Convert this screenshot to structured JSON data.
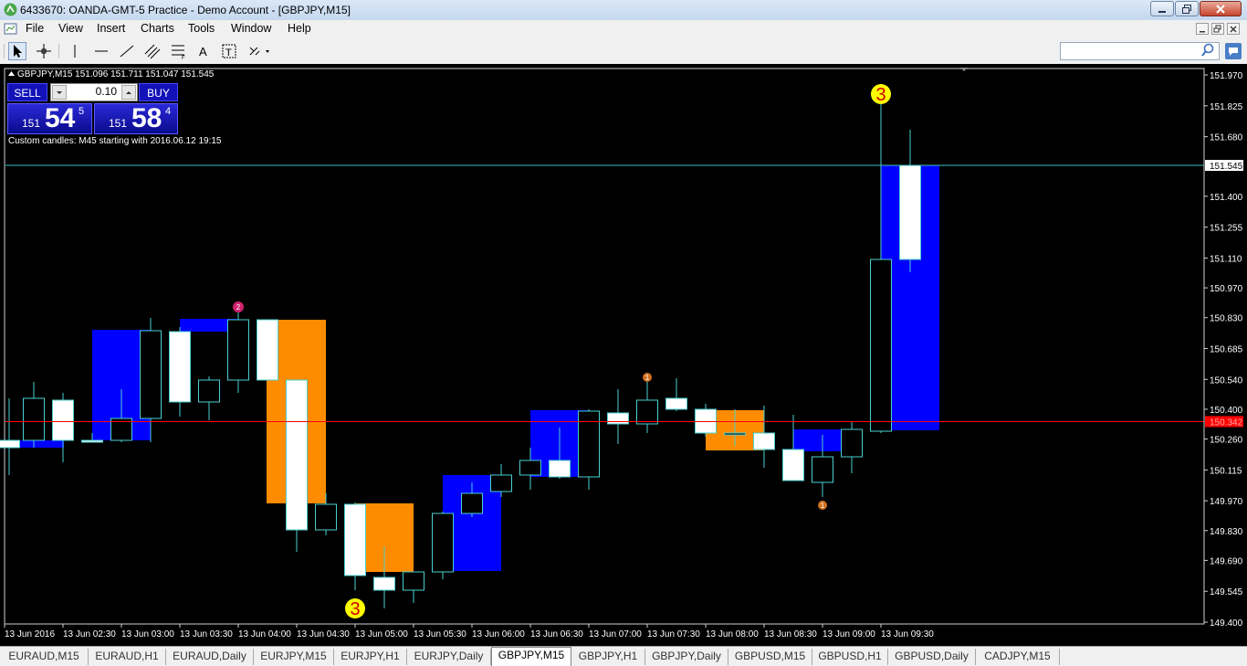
{
  "window": {
    "title": "6433670: OANDA-GMT-5 Practice - Demo Account - [GBPJPY,M15]"
  },
  "menu": [
    "File",
    "View",
    "Insert",
    "Charts",
    "Tools",
    "Window",
    "Help"
  ],
  "toolbar": {
    "icons": [
      "cursor-arrow-icon",
      "crosshair-icon",
      "vertical-line-icon",
      "horizontal-line-icon",
      "trendline-icon",
      "channel-icon",
      "fibonacci-icon",
      "text-icon",
      "text-label-icon",
      "arrows-icon"
    ],
    "search_placeholder": ""
  },
  "chart": {
    "header": "GBPJPY,M15  151.096 151.711 151.047 151.545",
    "note": "Custom candles: M45 starting with 2016.06.12 19:15",
    "quick_trade": {
      "sell_label": "SELL",
      "buy_label": "BUY",
      "lot": "0.10",
      "bid": {
        "big_prefix": "151",
        "big": "54",
        "sup": "5"
      },
      "ask": {
        "big_prefix": "151",
        "big": "58",
        "sup": "4"
      }
    },
    "price_axis": [
      "151.970",
      "151.825",
      "151.680",
      "151.545",
      "151.400",
      "151.255",
      "151.110",
      "150.970",
      "150.830",
      "150.685",
      "150.540",
      "150.400",
      "150.342",
      "150.260",
      "150.115",
      "149.970",
      "149.830",
      "149.690",
      "149.545",
      "149.400"
    ],
    "current_price": "151.545",
    "red_line_price": "150.342",
    "time_axis": [
      "13 Jun 2016",
      "13 Jun 02:30",
      "13 Jun 03:00",
      "13 Jun 03:30",
      "13 Jun 04:00",
      "13 Jun 04:30",
      "13 Jun 05:00",
      "13 Jun 05:30",
      "13 Jun 06:00",
      "13 Jun 06:30",
      "13 Jun 07:00",
      "13 Jun 07:30",
      "13 Jun 08:00",
      "13 Jun 08:30",
      "13 Jun 09:00",
      "13 Jun 09:30"
    ],
    "markers": [
      {
        "label": "3",
        "color": "#ffff00",
        "text_color": "#cc0000"
      },
      {
        "label": "3",
        "color": "#ffff00",
        "text_color": "#cc0000"
      },
      {
        "label": "2",
        "color": "#d02070",
        "text_color": "#ffffff"
      },
      {
        "label": "1",
        "color": "#d07020",
        "text_color": "#ffffff"
      },
      {
        "label": "1",
        "color": "#d07020",
        "text_color": "#ffffff"
      }
    ],
    "colors": {
      "bull": "#0000ff",
      "bear": "#ff8c00",
      "candle_outline": "#4ad0d0",
      "candle_body": "#ffffff",
      "bid_line": "#40c0c0",
      "red_line": "#ff0000"
    }
  },
  "symbol_tabs": [
    "EURAUD,M15",
    "EURAUD,H1",
    "EURAUD,Daily",
    "EURJPY,M15",
    "EURJPY,H1",
    "EURJPY,Daily",
    "GBPJPY,M15",
    "GBPJPY,H1",
    "GBPJPY,Daily",
    "GBPUSD,M15",
    "GBPUSD,H1",
    "GBPUSD,Daily",
    "CADJPY,M15"
  ],
  "active_tab": "GBPJPY,M15"
}
